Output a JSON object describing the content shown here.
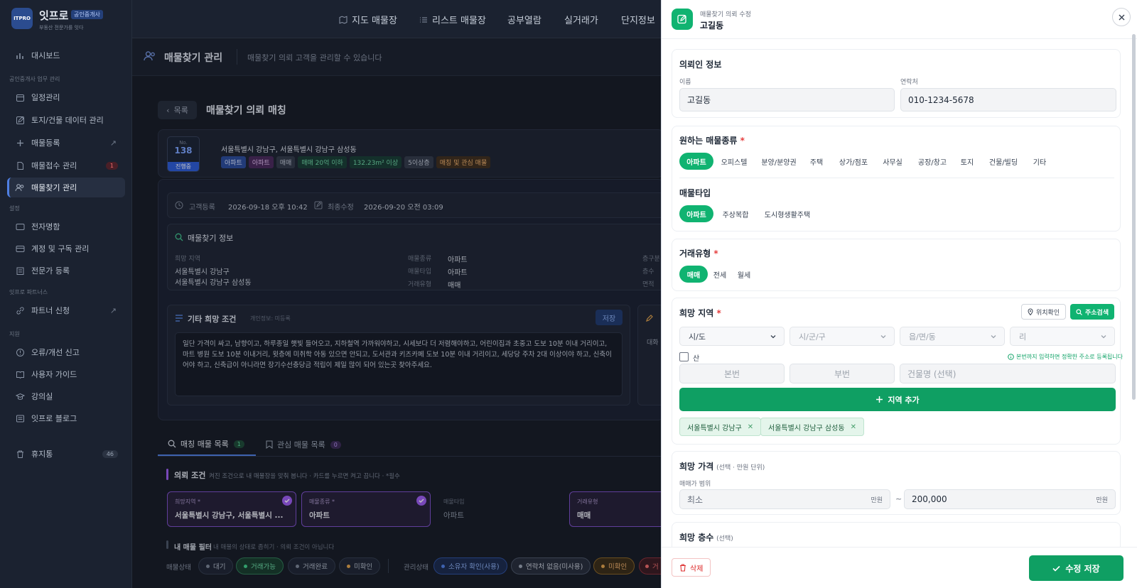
{
  "sidebar": {
    "brand": "잇프로",
    "badge": "공인중개사",
    "tagline": "부동산 전문가를 잇다",
    "logo_text": "ITPRO",
    "dashboard": "대시보드",
    "section_work": "공인중개사 업무 관리",
    "items": [
      {
        "label": "일정관리"
      },
      {
        "label": "토지/건물 데이터 관리"
      },
      {
        "label": "매물등록"
      },
      {
        "label": "매물접수 관리",
        "count": "1"
      },
      {
        "label": "매물찾기 관리"
      }
    ],
    "section_settings": "설정",
    "settings": [
      {
        "label": "전자명함"
      },
      {
        "label": "계정 및 구독 관리"
      },
      {
        "label": "전문가 등록"
      }
    ],
    "section_partner": "잇프로 파트너스",
    "partner": "파트너 신청",
    "section_support": "지원",
    "support": [
      {
        "label": "오류/개선 신고"
      },
      {
        "label": "사용자 가이드"
      },
      {
        "label": "강의실"
      },
      {
        "label": "잇프로 블로그"
      }
    ],
    "trash": "휴지통",
    "trash_count": "46"
  },
  "topnav": {
    "items": [
      "지도 매물장",
      "리스트 매물장",
      "공부열람",
      "실거래가",
      "단지정보"
    ]
  },
  "page": {
    "title": "매물찾기 관리",
    "subtitle": "매물찾기 의뢰 고객을 관리할 수 있습니다",
    "back": "목록",
    "heading": "매물찾기 의뢰 매칭"
  },
  "client": {
    "no_label": "No.",
    "no": "138",
    "status": "진행중",
    "address": "서울특별시 강남구, 서울특별시 강남구 삼성동",
    "chips": [
      "아파트",
      "아파트",
      "매매",
      "매매 20억 이하",
      "132.23m² 이상",
      "5이상층",
      "매칭 및 관심 매물"
    ],
    "reg_label": "고객등록",
    "reg_date": "2026-09-18 오후 10:42",
    "mod_label": "최종수정",
    "mod_date": "2026-09-20 오전 03:09"
  },
  "info": {
    "title": "매물찾기 정보",
    "area_label": "희망 지역",
    "areas": [
      "서울특별시 강남구",
      "서울특별시 강남구 삼성동"
    ],
    "kind_label": "매물종류",
    "kind": "아파트",
    "type_label": "매물타입",
    "type": "아파트",
    "deal_label": "거래유형",
    "deal": "매매",
    "extra_labels": [
      "층구분",
      "층수",
      "면적"
    ]
  },
  "etc": {
    "title": "기타 희망 조건",
    "note": "개인정보: 미등록",
    "save": "저장",
    "text": "일단 가격이 싸고, 남향이고, 하루종일 햇빛 들어오고, 지하철역 가까워야하고, 시세보다 더 저렴해야하고, 어린이집과 초중고 도보 10분 이내 거리이고, 마트 병원 도보 10분 이내거리, 윗층에 미취학 아동 있으면 안되고, 도서관과 키즈카페 도보 10분 이내 거리이고, 세당당 주차 2대 이상이야 하고, 신축이어야 하고, 신축급이 아니라면 장기수선충당금 적립이 제일 많이 되어 있는곳 찾아주세요.",
    "side_text": "대화"
  },
  "tabs": [
    {
      "label": "매칭 매물 목록",
      "count": "1"
    },
    {
      "label": "관심 매물 목록",
      "count": "0"
    }
  ],
  "conditions": {
    "title": "의뢰 조건",
    "desc": "켜진 조건으로 내 매물장을 맞춰 봅니다 · 카드를 누르면 켜고 끕니다 · *필수",
    "cards": [
      {
        "label": "희망지역 *",
        "value": "서울특별시 강남구, 서울특별시 ..."
      },
      {
        "label": "매물종류 *",
        "value": "아파트"
      },
      {
        "label": "매물타입",
        "value": "아파트"
      },
      {
        "label": "거래유형",
        "value": "매매"
      }
    ]
  },
  "filter": {
    "title": "내 매물 필터",
    "desc": "내 매물의 상태로 좁히기 · 의뢰 조건이 아닙니다",
    "state_label": "매물상태",
    "states": [
      "대기",
      "거래가능",
      "거래완료",
      "미확인"
    ],
    "mgmt_label": "관리상태",
    "mgmts": [
      "소유자 확인(사용)",
      "연락처 없음(미사용)",
      "미확인",
      "거"
    ]
  },
  "panel": {
    "subtitle": "매물찾기 의뢰 수정",
    "title": "고길동",
    "client_section": "의뢰인 정보",
    "name_label": "이름",
    "name": "고길동",
    "phone_label": "연락처",
    "phone": "010-1234-5678",
    "kind_section": "원하는 매물종류",
    "kinds": [
      "아파트",
      "오피스텔",
      "분양/분양권",
      "주택",
      "상가/점포",
      "사무실",
      "공장/창고",
      "토지",
      "건물/빌딩",
      "기타"
    ],
    "type_section": "매물타입",
    "types": [
      "아파트",
      "주상복합",
      "도시형생활주택"
    ],
    "deal_section": "거래유형",
    "deals": [
      "매매",
      "전세",
      "월세"
    ],
    "area_section": "희망 지역",
    "locate_btn": "위치확인",
    "search_btn": "주소검색",
    "selects": [
      "시/도",
      "시/군/구",
      "읍/면/동",
      "리"
    ],
    "mountain": "산",
    "hint": "본번까지 입력하면 정확한 주소로 등록됩니다",
    "main_no": "본번",
    "sub_no": "부번",
    "building": "건물명 (선택)",
    "add_btn": "지역 추가",
    "tags": [
      "서울특별시 강남구",
      "서울특별시 강남구 삼성동"
    ],
    "price_section": "희망 가격",
    "price_unit_note": "(선택 · 만원 단위)",
    "price_range_label": "매매가 범위",
    "price_min": "최소",
    "price_max": "200,000",
    "unit": "만원",
    "tilde": "~",
    "floor_section": "희망 층수",
    "floor_note": "(선택)",
    "delete_btn": "삭제",
    "save_btn": "수정 저장"
  },
  "colors": {
    "accent_green": "#10b371",
    "save_green": "#0f9f63",
    "dark_bg": "#161b24"
  }
}
